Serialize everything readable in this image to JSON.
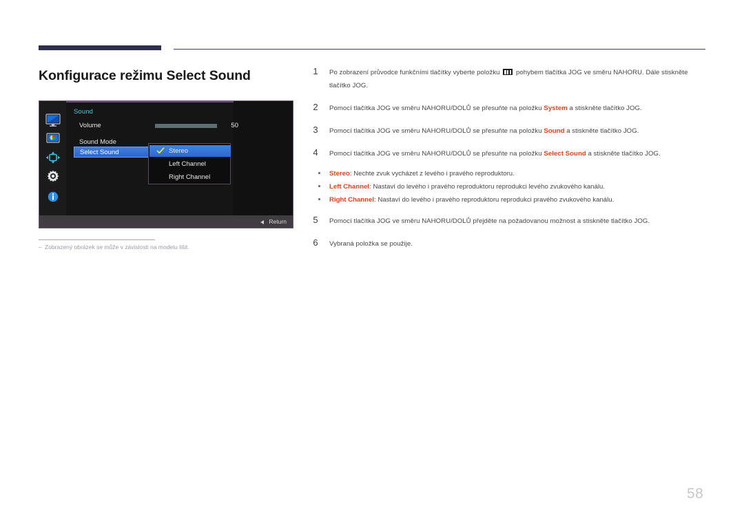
{
  "document": {
    "title": "Konfigurace režimu Select Sound",
    "page_number": "58",
    "footnote": "Zobrazený obrázek se může v závislosti na modelu lišit.",
    "footnote_dash": "‒"
  },
  "osd": {
    "heading": "Sound",
    "rows": [
      {
        "label": "Volume",
        "value": "50"
      },
      {
        "label": "Sound Mode",
        "value": ""
      },
      {
        "label": "Select Sound",
        "value": ""
      }
    ],
    "volume_percent": 50,
    "submenu": [
      {
        "label": "Stereo",
        "checked": true
      },
      {
        "label": "Left Channel",
        "checked": false
      },
      {
        "label": "Right Channel",
        "checked": false
      }
    ],
    "footer": {
      "return_label": "Return"
    },
    "rail_icons": [
      "display-icon",
      "picture-icon",
      "onscreen-display-icon",
      "system-gear-icon",
      "information-icon"
    ],
    "colors": {
      "heading": "#4ec6d8",
      "selection": "#3f7fe0",
      "check": "#d7e24a",
      "panel_border": "#6b4f7a"
    }
  },
  "steps": [
    {
      "num": "1",
      "parts": [
        {
          "t": "Po zobrazení průvodce funkčními tlačítky vyberte položku ",
          "hl": false
        },
        {
          "t": "MENU_GLYPH",
          "hl": false,
          "glyph": true
        },
        {
          "t": " pohybem tlačítka JOG ve směru NAHORU. Dále stiskněte tlačítko JOG.",
          "hl": false
        }
      ]
    },
    {
      "num": "2",
      "parts": [
        {
          "t": "Pomocí tlačítka JOG ve směru NAHORU/DOLŮ se přesuňte na položku ",
          "hl": false
        },
        {
          "t": "System",
          "hl": true
        },
        {
          "t": " a stiskněte tlačítko JOG.",
          "hl": false
        }
      ]
    },
    {
      "num": "3",
      "parts": [
        {
          "t": "Pomocí tlačítka JOG ve směru NAHORU/DOLŮ se přesuňte na položku ",
          "hl": false
        },
        {
          "t": "Sound",
          "hl": true
        },
        {
          "t": " a stiskněte tlačítko JOG.",
          "hl": false
        }
      ]
    },
    {
      "num": "4",
      "parts": [
        {
          "t": "Pomocí tlačítka JOG ve směru NAHORU/DOLŮ se přesuňte na položku ",
          "hl": false
        },
        {
          "t": "Select Sound",
          "hl": true
        },
        {
          "t": " a stiskněte tlačítko JOG.",
          "hl": false
        }
      ]
    }
  ],
  "bullets": [
    {
      "term": "Stereo",
      "desc": ": Nechte zvuk vycházet z levého i pravého reproduktoru."
    },
    {
      "term": "Left Channel",
      "desc": ": Nastaví do levého i pravého reproduktoru reprodukci levého zvukového kanálu."
    },
    {
      "term": "Right Channel",
      "desc": ": Nastaví do levého i pravého reproduktoru reprodukci pravého zvukového kanálu."
    }
  ],
  "steps_after": [
    {
      "num": "5",
      "parts": [
        {
          "t": "Pomocí tlačítka JOG ve směru NAHORU/DOLŮ přejděte na požadovanou možnost a stiskněte tlačítko JOG.",
          "hl": false
        }
      ]
    },
    {
      "num": "6",
      "parts": [
        {
          "t": "Vybraná položka se použije.",
          "hl": false
        }
      ]
    }
  ]
}
